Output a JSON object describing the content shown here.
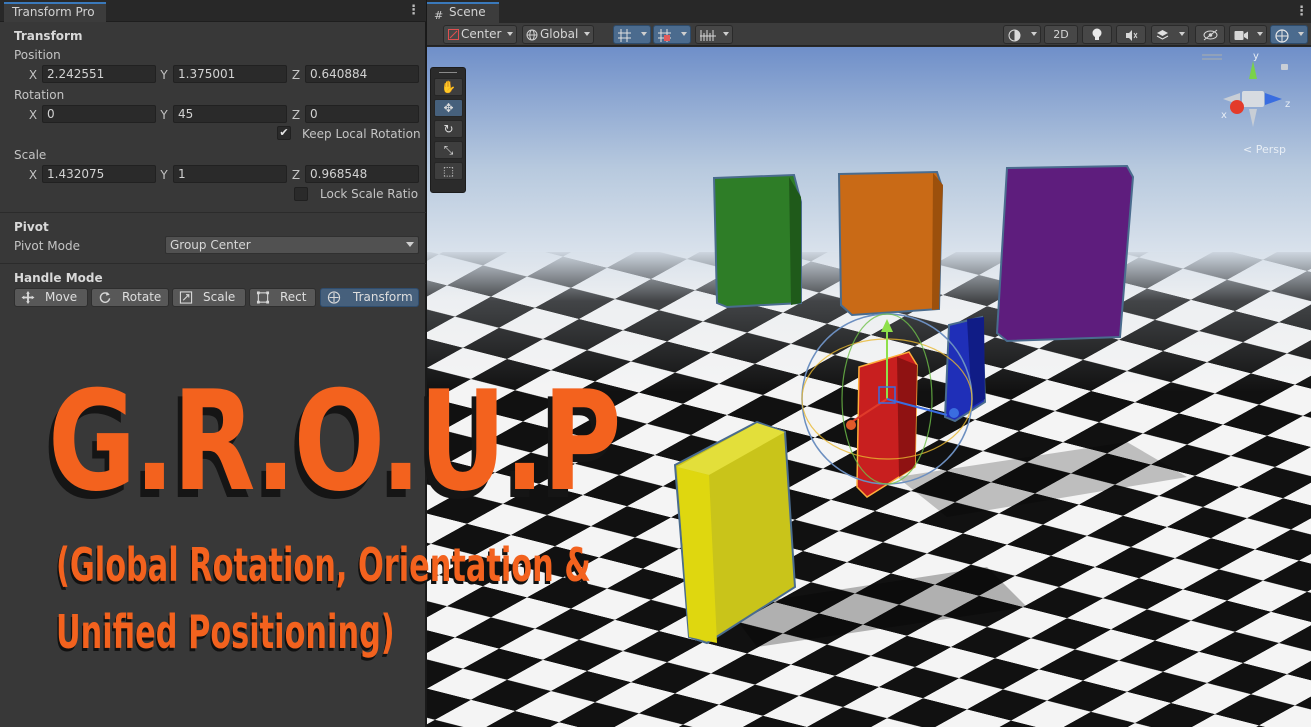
{
  "inspector": {
    "tab_title": "Transform Pro",
    "transform": {
      "header": "Transform",
      "position_label": "Position",
      "position": {
        "x_label": "X",
        "x": "2.242551",
        "y_label": "Y",
        "y": "1.375001",
        "z_label": "Z",
        "z": "0.640884"
      },
      "rotation_label": "Rotation",
      "rotation": {
        "x_label": "X",
        "x": "0",
        "y_label": "Y",
        "y": "45",
        "z_label": "Z",
        "z": "0"
      },
      "keep_local_rotation_label": "Keep Local Rotation",
      "keep_local_rotation_checked": true,
      "scale_label": "Scale",
      "scale": {
        "x_label": "X",
        "x": "1.432075",
        "y_label": "Y",
        "y": "1",
        "z_label": "Z",
        "z": "0.968548"
      },
      "lock_scale_ratio_label": "Lock Scale Ratio",
      "lock_scale_ratio_checked": false
    },
    "pivot": {
      "header": "Pivot",
      "mode_label": "Pivot Mode",
      "mode_value": "Group Center"
    },
    "handle_mode": {
      "header": "Handle Mode",
      "buttons": [
        {
          "label": "Move",
          "icon": "move-icon",
          "active": false
        },
        {
          "label": "Rotate",
          "icon": "rotate-icon",
          "active": false
        },
        {
          "label": "Scale",
          "icon": "scale-icon",
          "active": false
        },
        {
          "label": "Rect",
          "icon": "rect-icon",
          "active": false
        },
        {
          "label": "Transform",
          "icon": "transform-icon",
          "active": true
        }
      ]
    }
  },
  "scene": {
    "tab_title": "Scene",
    "toolbar": {
      "pivot_mode": "Center",
      "space_mode": "Global",
      "mode_2d": "2D"
    },
    "gizmo": {
      "x_label": "x",
      "y_label": "y",
      "z_label": "z",
      "projection_label": "Persp"
    },
    "colors": {
      "green_block": "#2e7d27",
      "orange_block": "#c96a16",
      "purple_block": "#5e1d7d",
      "red_block": "#c81f1f",
      "blue_block": "#1f2fb8",
      "yellow_block": "#c9c41a",
      "title_orange": "#f3621e"
    }
  },
  "overlay": {
    "title": "G.R.O.U.P",
    "subtitle_line1": "(Global Rotation, Orientation &",
    "subtitle_line2": "Unified Positioning)"
  }
}
